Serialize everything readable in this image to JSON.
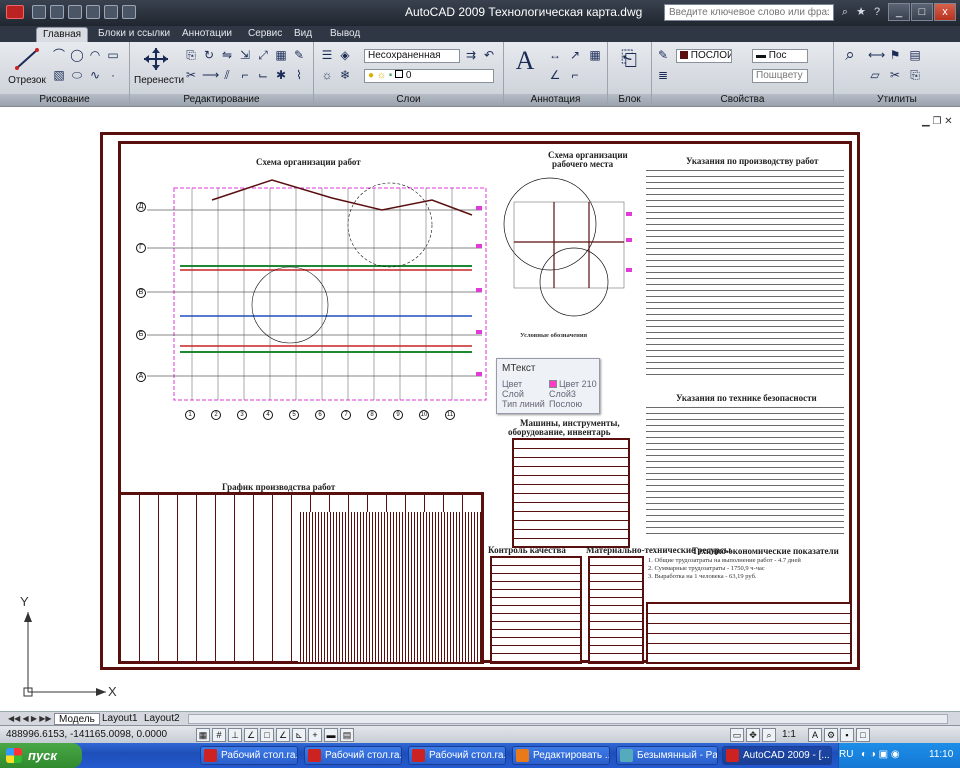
{
  "titlebar": {
    "title": "AutoCAD 2009  Технологическая карта.dwg",
    "search_placeholder": "Введите ключевое слово или фразу",
    "minimize": "_",
    "maximize": "□",
    "close": "x"
  },
  "tabs": [
    {
      "label": "Главная"
    },
    {
      "label": "Блоки и ссылки"
    },
    {
      "label": "Аннотации"
    },
    {
      "label": "Сервис"
    },
    {
      "label": "Вид"
    },
    {
      "label": "Вывод"
    }
  ],
  "ribbon": {
    "panels": {
      "draw": "Рисование",
      "modify": "Редактирование",
      "layers": "Слои",
      "annotation": "Аннотация",
      "block": "Блок",
      "properties": "Свойства",
      "utilities": "Утилиты"
    },
    "line_label": "Отрезок",
    "move_label": "Перенести",
    "layer_state": "Несохраненная",
    "layer_current": "0",
    "color_value": "ПОСЛОЙ",
    "linetype_value": "Пос",
    "lineweight_value": "Пошцвету",
    "colors": {
      "accent": "#5a0f0f",
      "ribbon_bg": "#d5d9df"
    }
  },
  "drawing": {
    "titles": {
      "scheme": "Схема организации работ",
      "workplace_1": "Схема организации",
      "workplace_2": "рабочего места",
      "instructions": "Указания по производству работ",
      "safety": "Указания по технике безопасности",
      "machines": "Машины, инструменты,",
      "machines_2": "оборудование, инвентарь",
      "schedule": "График производства работ",
      "quality": "Контроль качества",
      "materials": "Материально-технические ресурсы",
      "economics": "Технико-экономические показатели"
    },
    "economics_lines": [
      "1. Общие трудозатраты на выполнение работ - 4.7 дней",
      "2. Суммарные трудозатраты - 1750,9 ч-час",
      "3. Выработка на 1 человека - 63,19 руб."
    ],
    "axis_letters": [
      "Д",
      "Г",
      "В",
      "Б",
      "А"
    ],
    "axis_numbers": [
      "1",
      "2",
      "3",
      "4",
      "5",
      "6",
      "7",
      "8",
      "9",
      "10",
      "11",
      "12",
      "13"
    ],
    "legend": "Условные обозначения"
  },
  "tooltip": {
    "header": "МТекст",
    "color_label": "Цвет",
    "color_value": "Цвет 210",
    "layer_label": "Слой",
    "layer_value": "Слой3",
    "linetype_label": "Тип линий",
    "linetype_value": "Послою",
    "swatch": "#ff3ac8"
  },
  "ucs": {
    "y": "Y",
    "x": "X"
  },
  "layout_tabs": [
    {
      "label": "Модель"
    },
    {
      "label": "Layout1"
    },
    {
      "label": "Layout2"
    }
  ],
  "status": {
    "coords": "488996.6153, -141165.0098, 0.0000",
    "scale": "1:1"
  },
  "taskbar": {
    "start": "пуск",
    "tasks": [
      {
        "label": "Рабочий стол.ra..."
      },
      {
        "label": "Рабочий стол.ra..."
      },
      {
        "label": "Рабочий стол.ra..."
      },
      {
        "label": "Редактировать ..."
      },
      {
        "label": "Безымянный - Paint"
      },
      {
        "label": "AutoCAD 2009 - [..."
      }
    ],
    "lang": "RU",
    "clock": "11:10"
  }
}
